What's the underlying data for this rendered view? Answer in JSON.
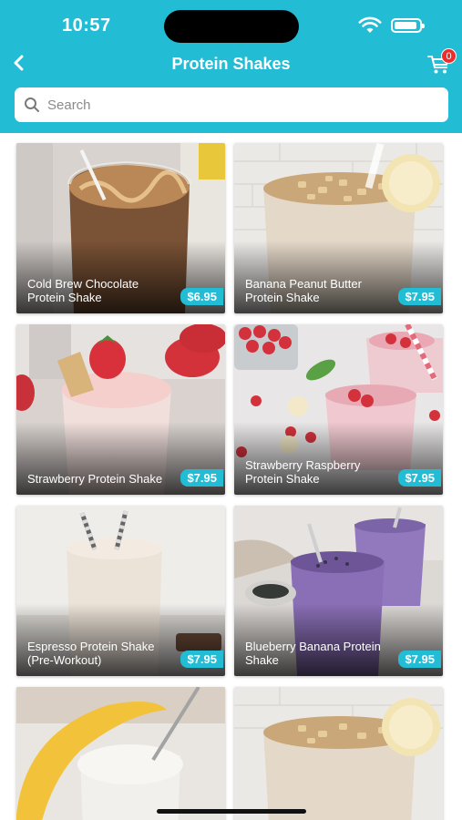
{
  "status": {
    "time": "10:57"
  },
  "header": {
    "title": "Protein Shakes",
    "back_icon": "chevron-left-icon",
    "cart_icon": "cart-icon",
    "cart_count": "0",
    "colors": {
      "bar": "#22bcd5",
      "badge": "#ef2b2b"
    }
  },
  "search": {
    "placeholder": "Search",
    "value": ""
  },
  "products": [
    {
      "name": "Cold Brew Chocolate Protein Shake",
      "price": "$6.95"
    },
    {
      "name": "Banana Peanut Butter Protein Shake",
      "price": "$7.95"
    },
    {
      "name": "Strawberry Protein Shake",
      "price": "$7.95"
    },
    {
      "name": "Strawberry Raspberry Protein Shake",
      "price": "$7.95"
    },
    {
      "name": "Espresso Protein Shake (Pre-Workout)",
      "price": "$7.95"
    },
    {
      "name": "Blueberry Banana Protein Shake",
      "price": "$7.95"
    },
    {
      "name": "",
      "price": ""
    },
    {
      "name": "",
      "price": ""
    }
  ]
}
